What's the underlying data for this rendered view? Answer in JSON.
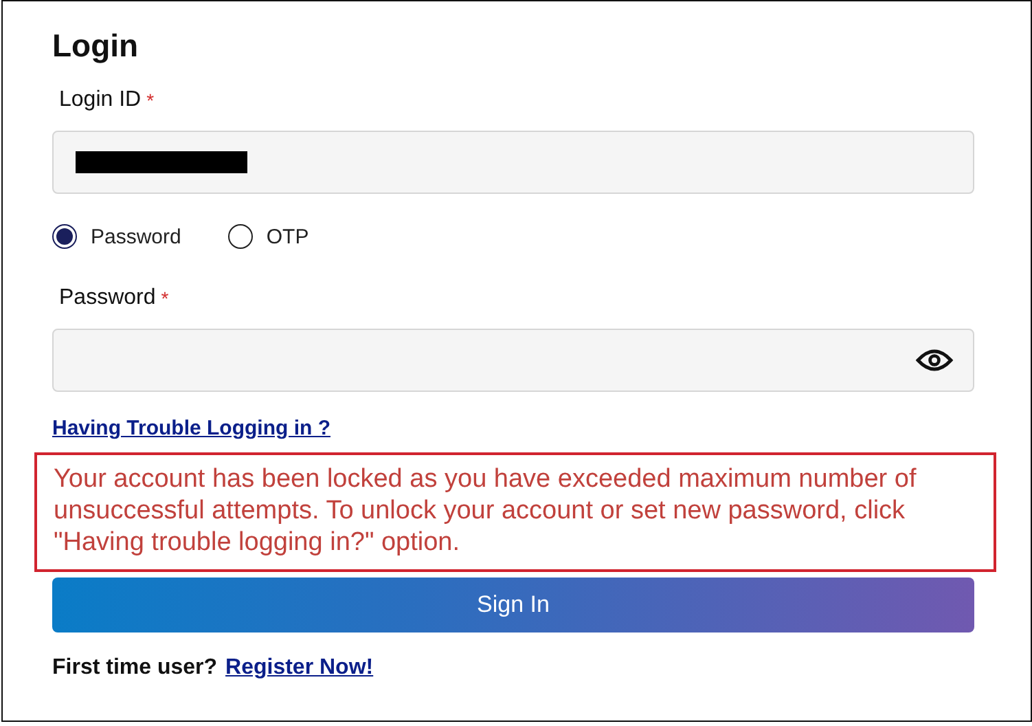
{
  "title": "Login",
  "login_id": {
    "label": "Login ID",
    "required_mark": "*",
    "redacted": true
  },
  "auth_options": [
    {
      "label": "Password",
      "selected": true
    },
    {
      "label": "OTP",
      "selected": false
    }
  ],
  "password": {
    "label": "Password",
    "required_mark": "*"
  },
  "trouble_link": "Having Trouble Logging in ?",
  "error_message": "Your account has been locked as you have exceeded maximum number of unsuccessful attempts. To unlock your account or set new password, click \"Having trouble logging in?\" option.",
  "sign_in_button": "Sign In",
  "footer": {
    "prompt": "First time user?",
    "register_link": "Register Now!"
  }
}
